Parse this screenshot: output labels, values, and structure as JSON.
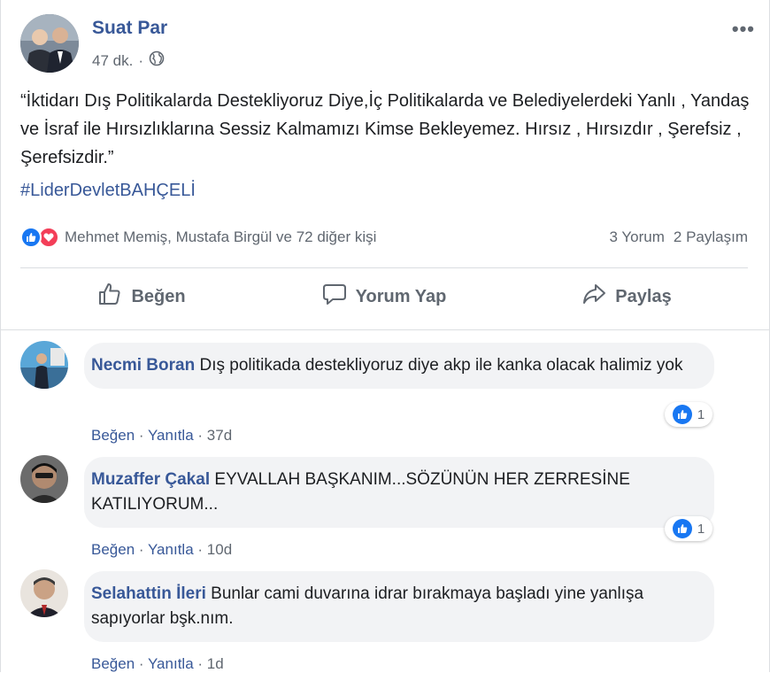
{
  "post": {
    "author": "Suat Par",
    "time": "47 dk.",
    "separator": "·",
    "text": "“İktidarı Dış Politikalarda Destekliyoruz Diye,İç Politikalarda ve Belediyelerdeki Yanlı , Yandaş ve İsraf ile Hırsızlıklarına Sessiz Kalmamızı Kimse Bekleyemez. Hırsız , Hırsızdır , Şerefsiz , Şerefsizdir.”",
    "hashtag": "#LiderDevletBAHÇELİ",
    "more": "•••"
  },
  "reactions": {
    "summary": "Mehmet Memiş, Mustafa Birgül ve 72 diğer kişi",
    "comments_count": "3 Yorum",
    "shares_count": "2 Paylaşım"
  },
  "actions": {
    "like": "Beğen",
    "comment": "Yorum Yap",
    "share": "Paylaş"
  },
  "comments": [
    {
      "name": "Necmi Boran",
      "text": "Dış politikada destekliyoruz diye akp ile kanka olacak halimiz yok",
      "like": "Beğen",
      "reply": "Yanıtla",
      "time": "37d",
      "reactions": "1"
    },
    {
      "name": "Muzaffer Çakal",
      "text": "EYVALLAH BAŞKANIM...SÖZÜNÜN HER ZERRESİNE KATILIYORUM...",
      "like": "Beğen",
      "reply": "Yanıtla",
      "time": "10d",
      "reactions": "1"
    },
    {
      "name": "Selahattin İleri",
      "text": "Bunlar cami duvarına idrar bırakmaya başladı yine yanlışa sapıyorlar bşk.nım.",
      "like": "Beğen",
      "reply": "Yanıtla",
      "time": "1d"
    }
  ],
  "colors": {
    "link": "#385898",
    "like_blue": "#1877f2",
    "love_red": "#f33e58"
  }
}
